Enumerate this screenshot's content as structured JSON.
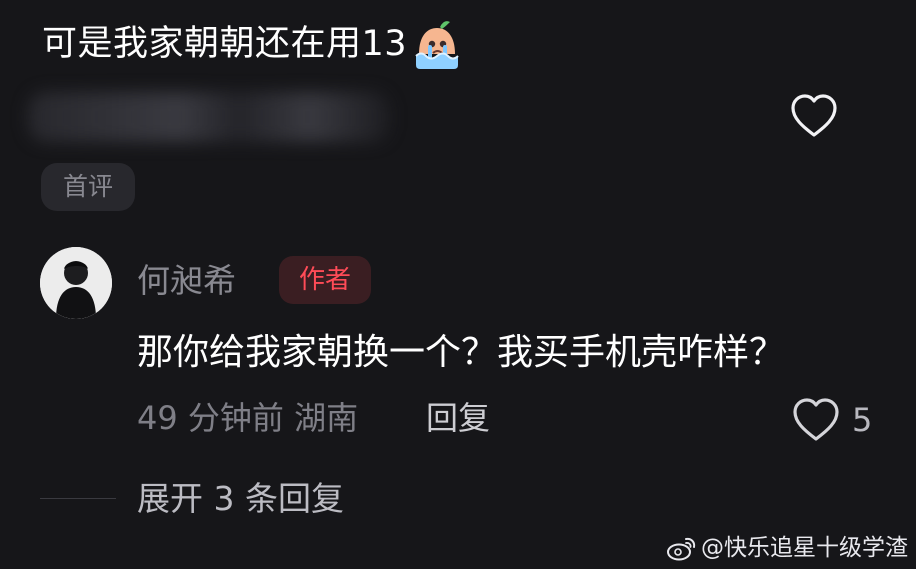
{
  "top_comment": {
    "text": "可是我家朝朝还在用13",
    "emoji": "crying-face-emoji"
  },
  "first_badge": "首评",
  "reply": {
    "author": "何昶希",
    "author_badge": "作者",
    "text": "那你给我家朝换一个？我买手机壳咋样？",
    "time": "49 分钟前",
    "location": "湖南",
    "reply_label": "回复",
    "likes": "5"
  },
  "expand_label": "展开 3 条回复",
  "watermark": {
    "text": "@快乐追星十级学渣",
    "icon": "weibo-icon"
  },
  "colors": {
    "background": "#161619",
    "author_badge_text": "#ff4b57",
    "author_badge_bg": "#3a1e22"
  }
}
